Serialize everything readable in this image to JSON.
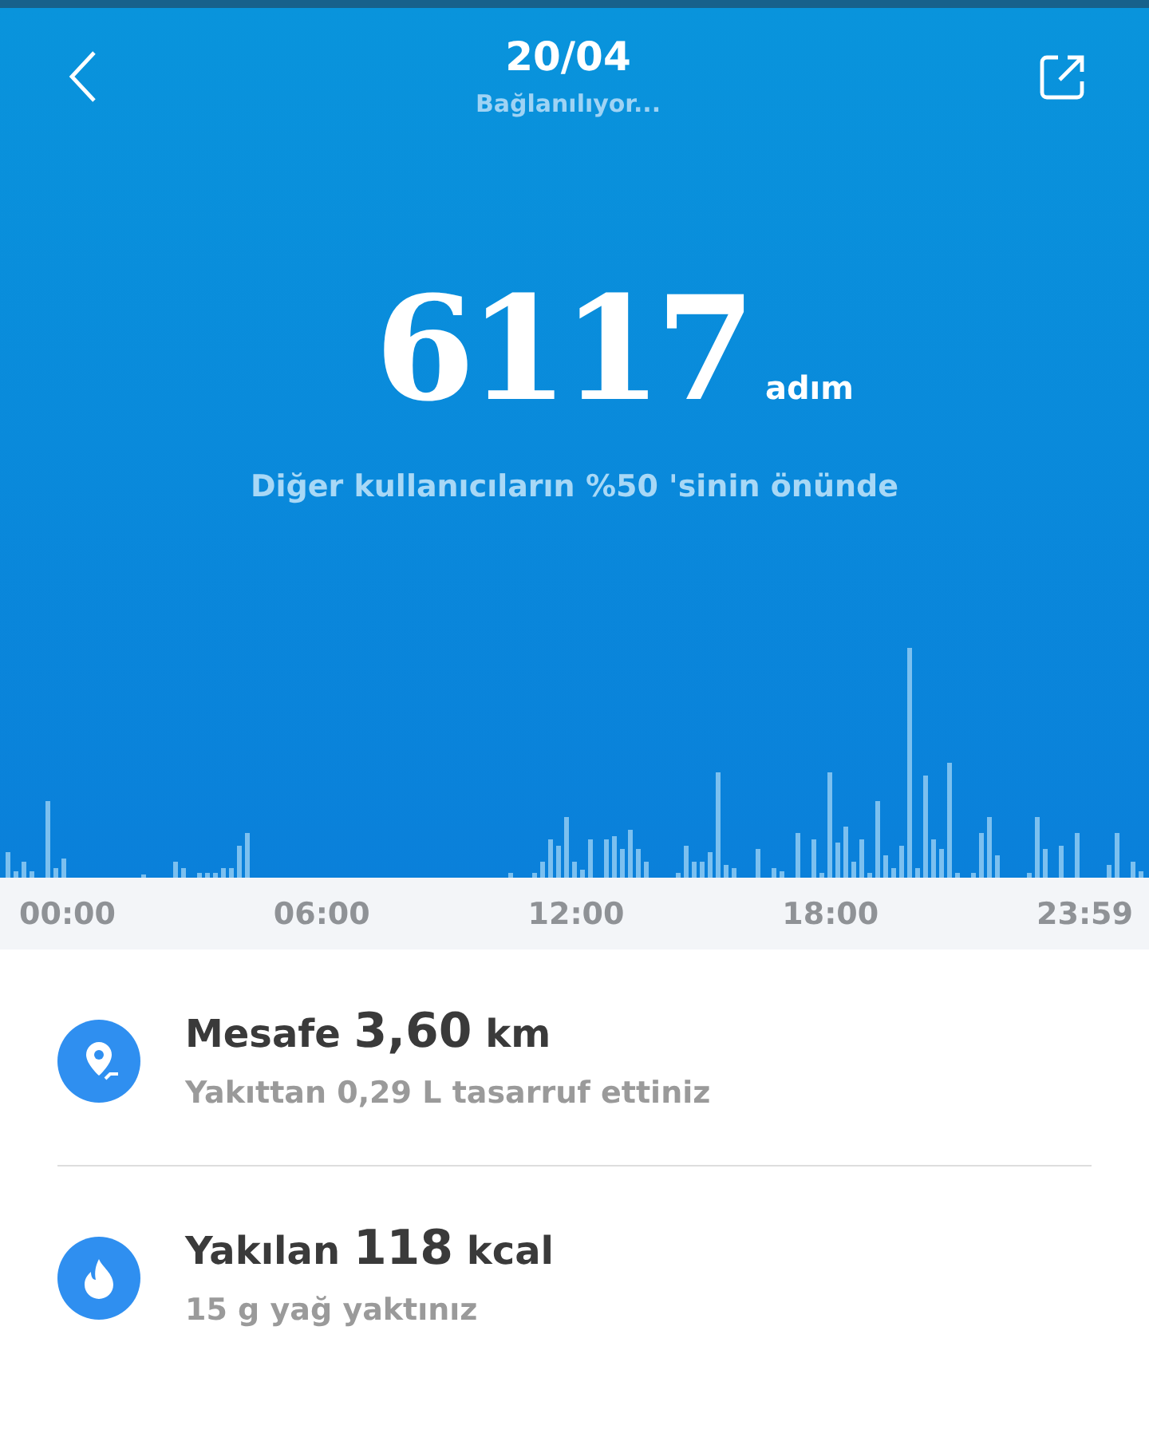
{
  "header": {
    "title": "20/04",
    "subtitle": "Bağlanılıyor..."
  },
  "steps": {
    "value": "6117",
    "unit": "adım",
    "comparison": "Diğer kullanıcıların %50 'sinin önünde"
  },
  "activity_chart": {
    "time_labels": [
      "00:00",
      "06:00",
      "12:00",
      "18:00",
      "23:59"
    ]
  },
  "stats": [
    {
      "kind": "distance",
      "label": "Mesafe",
      "value": "3,60",
      "unit": "km",
      "note": "Yakıttan 0,29 L tasarruf ettiniz"
    },
    {
      "kind": "calories",
      "label": "Yakılan",
      "value": "118",
      "unit": "kcal",
      "note": "15 g yağ yaktınız"
    }
  ]
}
